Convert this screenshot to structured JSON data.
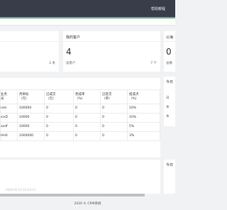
{
  "header": {
    "help_label": "帮助教程"
  },
  "cards": [
    {
      "title": "",
      "count": "",
      "sub_left": "",
      "sub_right": "2 条"
    },
    {
      "title": "我的客户",
      "count": "4",
      "sub_left": "总客户",
      "sub_right": "7 个"
    },
    {
      "title": "公海",
      "count": "0",
      "sub_left": "总数",
      "sub_right": ""
    }
  ],
  "table": {
    "headers": [
      {
        "line1": "业务",
        "line2": "员"
      },
      {
        "line1": "月目标",
        "line2": "（元）"
      },
      {
        "line1": "已成交",
        "line2": "（元）"
      },
      {
        "line1": "完成率",
        "line2": "（%）"
      },
      {
        "line1": "已签交",
        "line2": "（单）"
      },
      {
        "line1": "提成点",
        "line2": "（%）"
      }
    ],
    "rows": [
      [
        "nmi",
        "100000",
        "0",
        "0",
        "0",
        "10%"
      ],
      [
        "sinD",
        "10000",
        "0",
        "0",
        "0",
        "10%"
      ],
      [
        "asdf",
        "10000",
        "0",
        "0",
        "0",
        "5%"
      ],
      [
        "HHX",
        "1000000",
        "0",
        "0",
        "0",
        "3%"
      ]
    ]
  },
  "side": {
    "card1_title": "今日",
    "card1_rows": [
      "日",
      "本",
      "本"
    ],
    "card2_title": "今日"
  },
  "bottom": {
    "timestamp": "2020-07-21 15:43:17"
  },
  "footer": {
    "text": "2020 © CRM系统"
  }
}
